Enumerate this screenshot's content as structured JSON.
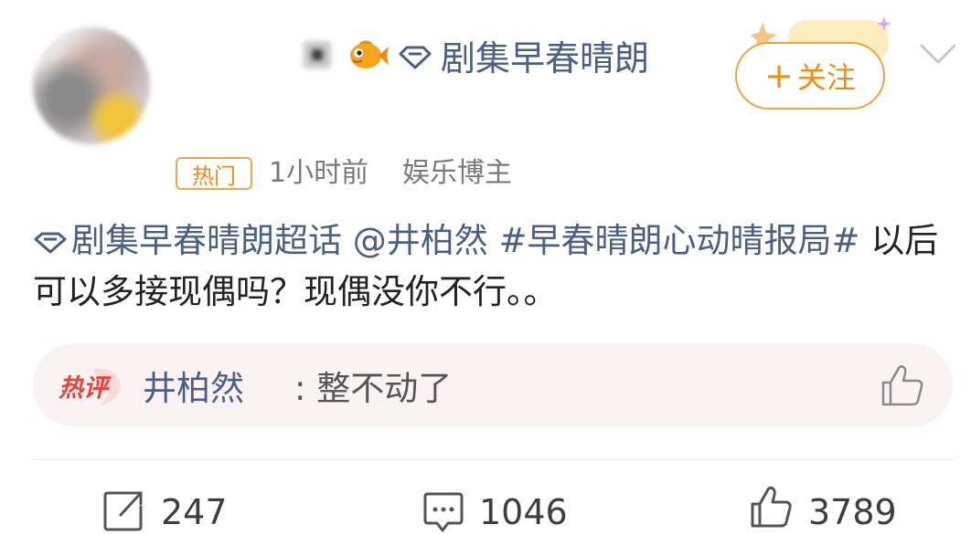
{
  "header": {
    "topic_name": "剧集早春晴朗",
    "follow_label": "关注",
    "follow_plus": "+"
  },
  "meta": {
    "hot_badge": "热门",
    "time": "1小时前",
    "role": "娱乐博主"
  },
  "post": {
    "supertopic": "剧集早春晴朗超话",
    "mention": "@井柏然",
    "hashtag": "#早春晴朗心动晴报局#",
    "text": " 以后可以多接现偶吗？现偶没你不行。。"
  },
  "hot_comment": {
    "badge": "热评",
    "user": "井柏然",
    "text": ": 整不动了"
  },
  "actions": {
    "repost_count": "247",
    "comment_count": "1046",
    "like_count": "3789"
  },
  "colors": {
    "link": "#4b5f85",
    "accent": "#f28b10",
    "hot_red": "#e8433b"
  },
  "icons": [
    "fish-badge-icon",
    "diamond-icon",
    "chevron-down-icon",
    "thumbs-up-icon",
    "repost-icon",
    "comment-icon"
  ]
}
